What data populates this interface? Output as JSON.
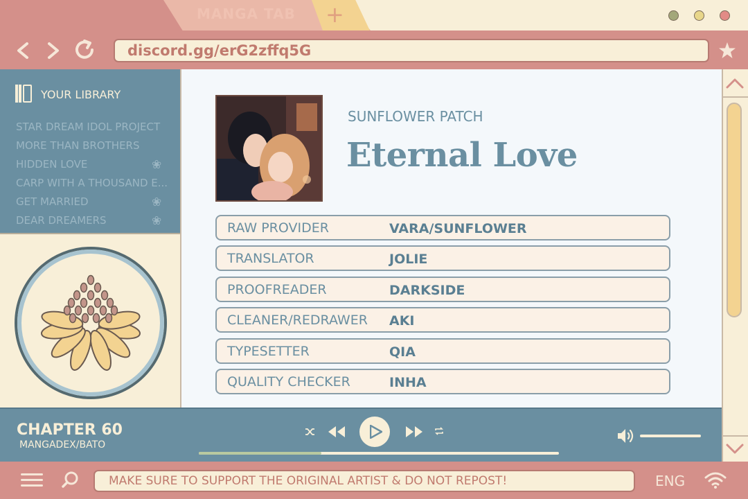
{
  "browser": {
    "tab_title": "MANGA TAB",
    "new_tab": "+",
    "url": "discord.gg/erG2zffq5G",
    "window_dot_colors": [
      "#a3a77a",
      "#e8d68a",
      "#e28b86"
    ]
  },
  "sidebar": {
    "title": "YOUR LIBRARY",
    "items": [
      {
        "label": "STAR DREAM IDOL PROJECT",
        "flower": false
      },
      {
        "label": "MORE THAN BROTHERS",
        "flower": false
      },
      {
        "label": "HIDDEN LOVE",
        "flower": true
      },
      {
        "label": "CARP WITH A THOUSAND E...",
        "flower": false
      },
      {
        "label": "GET MARRIED",
        "flower": true
      },
      {
        "label": "DEAR DREAMERS",
        "flower": true
      }
    ]
  },
  "main": {
    "group": "SUNFLOWER PATCH",
    "title": "Eternal Love",
    "credits": [
      {
        "role": "RAW PROVIDER",
        "name": "VARA/SUNFLOWER"
      },
      {
        "role": "TRANSLATOR",
        "name": "JOLIE"
      },
      {
        "role": "PROOFREADER",
        "name": "DARKSIDE"
      },
      {
        "role": "CLEANER/REDRAWER",
        "name": "AKI"
      },
      {
        "role": "TYPESETTER",
        "name": "QIA"
      },
      {
        "role": "QUALITY CHECKER",
        "name": "INHA"
      }
    ]
  },
  "player": {
    "chapter": "CHAPTER 60",
    "source": "MANGADEX/BATO",
    "progress": 0.34,
    "volume": 1.0
  },
  "footer": {
    "notice": "MAKE SURE TO SUPPORT THE ORIGINAL ARTIST & DO NOT REPOST!",
    "language": "ENG"
  },
  "colors": {
    "frame": "#d4908a",
    "accent_blue": "#6a8fa1",
    "cream": "#f8efd8",
    "yellow": "#f3d391"
  }
}
